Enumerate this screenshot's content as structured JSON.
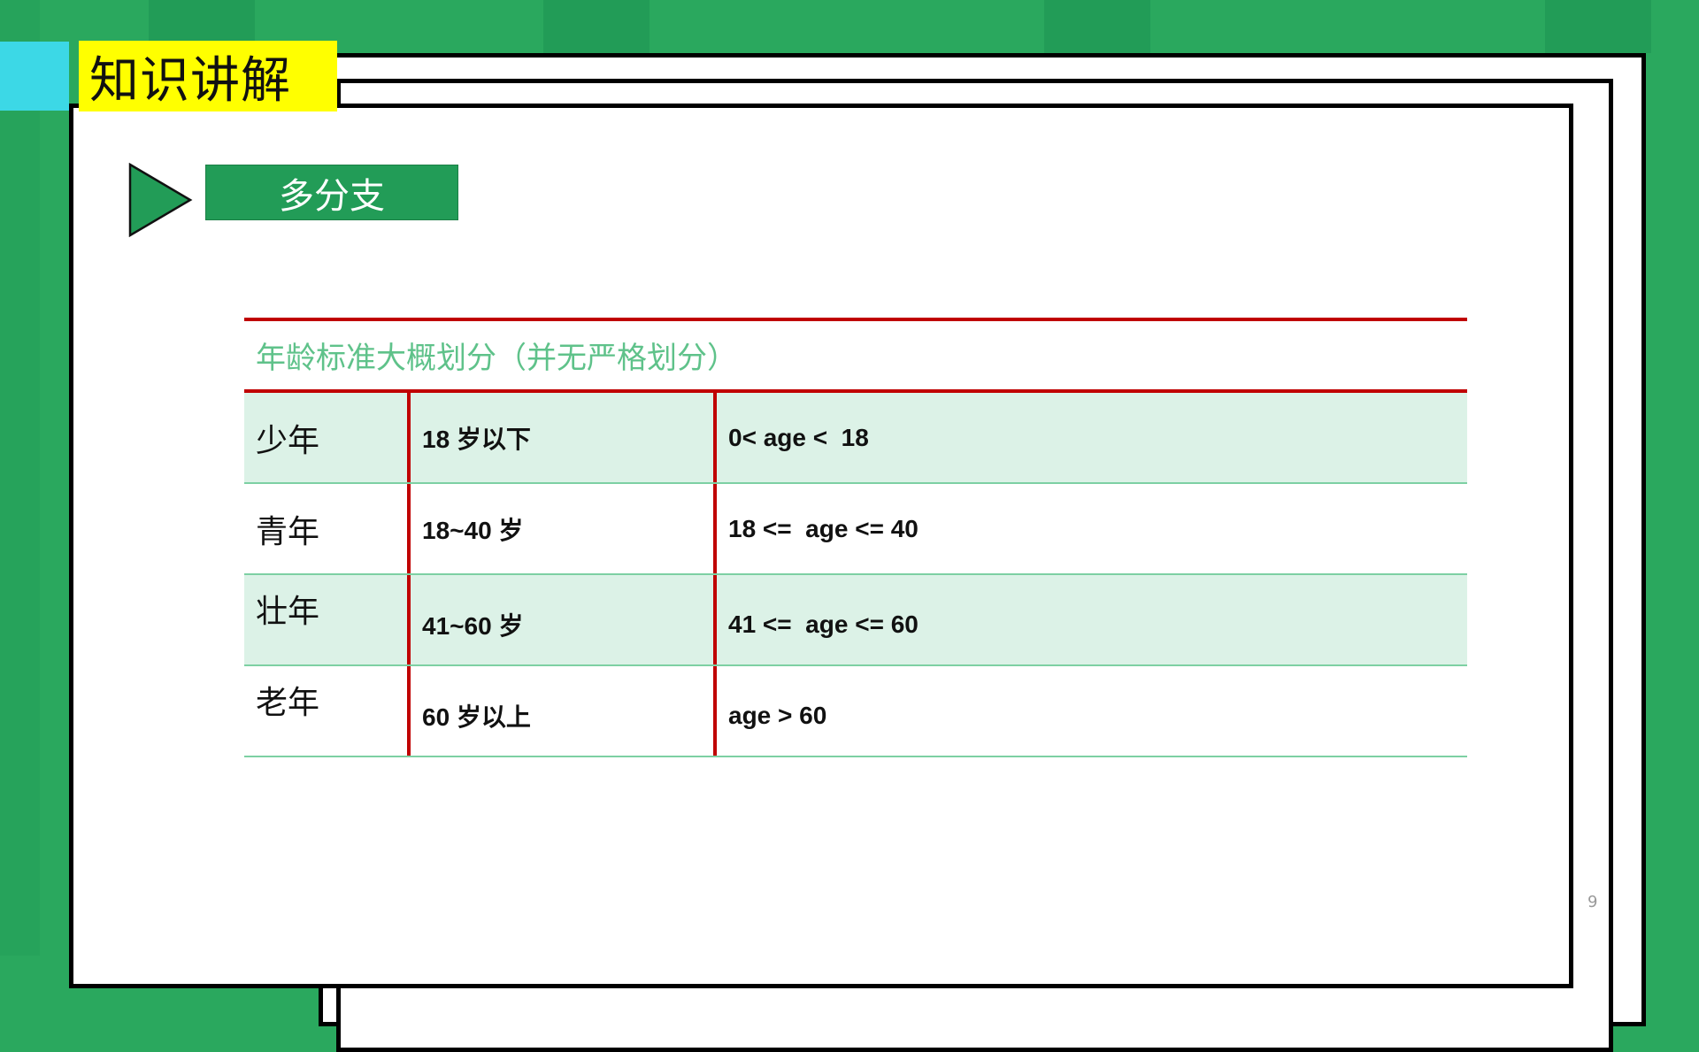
{
  "slide": {
    "title": "知识讲解",
    "section_label": "多分支",
    "page_number": "9"
  },
  "table": {
    "title": "年龄标准大概划分（并无严格划分）",
    "rows": [
      {
        "group": "少年",
        "range": "18 岁以下",
        "condition": "0< age <  18"
      },
      {
        "group": "青年",
        "range": "18~40 岁",
        "condition": "18 <=  age <= 40"
      },
      {
        "group": "壮年",
        "range": "41~60 岁",
        "condition": "41 <=  age <= 60"
      },
      {
        "group": "老年",
        "range": "60 岁以上",
        "condition": "age > 60"
      }
    ]
  },
  "colors": {
    "background_green": "#2aa85e",
    "title_yellow": "#ffff00",
    "accent_cyan": "#3cd8e6",
    "label_green": "#229c57",
    "rule_red": "#c00000",
    "row_shade": "#dcf2e7",
    "table_title_green": "#5fc28a"
  },
  "icons": {
    "section_marker": "play-triangle-icon"
  }
}
